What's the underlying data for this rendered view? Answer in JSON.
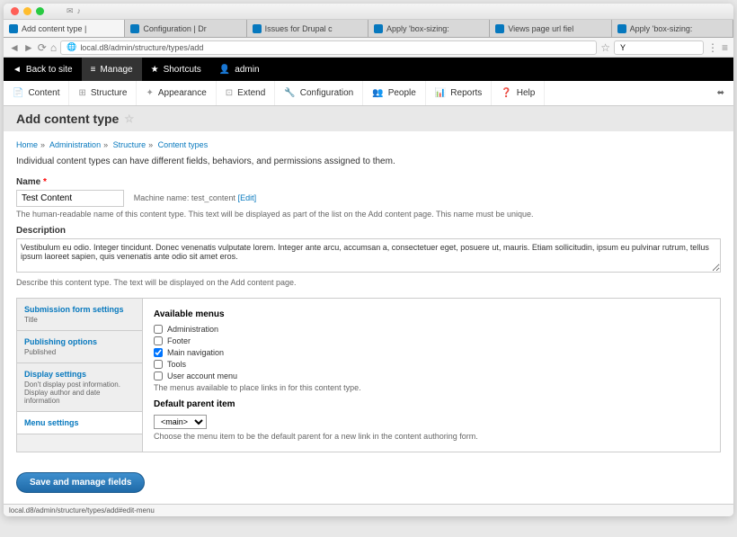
{
  "browser": {
    "tabs": [
      {
        "label": "Add content type |",
        "active": true
      },
      {
        "label": "Configuration | Dr"
      },
      {
        "label": "Issues for Drupal c"
      },
      {
        "label": "Apply 'box-sizing:"
      },
      {
        "label": "Views page url fiel"
      },
      {
        "label": "Apply 'box-sizing:"
      }
    ],
    "url": "local.d8/admin/structure/types/add",
    "search_placeholder": "Y"
  },
  "adminbar": {
    "back": "Back to site",
    "manage": "Manage",
    "shortcuts": "Shortcuts",
    "user": "admin"
  },
  "toolbar": {
    "content": "Content",
    "structure": "Structure",
    "appearance": "Appearance",
    "extend": "Extend",
    "configuration": "Configuration",
    "people": "People",
    "reports": "Reports",
    "help": "Help"
  },
  "page": {
    "title": "Add content type",
    "breadcrumb": [
      "Home",
      "Administration",
      "Structure",
      "Content types"
    ],
    "intro": "Individual content types can have different fields, behaviors, and permissions assigned to them."
  },
  "name": {
    "label": "Name",
    "value": "Test Content",
    "machine_label": "Machine name:",
    "machine_value": "test_content",
    "edit": "[Edit]",
    "help": "The human-readable name of this content type. This text will be displayed as part of the list on the Add content page. This name must be unique."
  },
  "description": {
    "label": "Description",
    "value": "Vestibulum eu odio. Integer tincidunt. Donec venenatis vulputate lorem. Integer ante arcu, accumsan a, consectetuer eget, posuere ut, mauris. Etiam sollicitudin, ipsum eu pulvinar rutrum, tellus ipsum laoreet sapien, quis venenatis ante odio sit amet eros.",
    "help": "Describe this content type. The text will be displayed on the Add content page."
  },
  "vtabs": [
    {
      "title": "Submission form settings",
      "sub": "Title"
    },
    {
      "title": "Publishing options",
      "sub": "Published"
    },
    {
      "title": "Display settings",
      "sub": "Don't display post information. Display author and date information"
    },
    {
      "title": "Menu settings",
      "sub": ""
    }
  ],
  "menus": {
    "title": "Available menus",
    "items": [
      {
        "label": "Administration",
        "checked": false
      },
      {
        "label": "Footer",
        "checked": false
      },
      {
        "label": "Main navigation",
        "checked": true
      },
      {
        "label": "Tools",
        "checked": false
      },
      {
        "label": "User account menu",
        "checked": false
      }
    ],
    "help": "The menus available to place links in for this content type.",
    "parent_label": "Default parent item",
    "parent_value": "<main>",
    "parent_help": "Choose the menu item to be the default parent for a new link in the content authoring form."
  },
  "save": "Save and manage fields",
  "status": "local.d8/admin/structure/types/add#edit-menu"
}
